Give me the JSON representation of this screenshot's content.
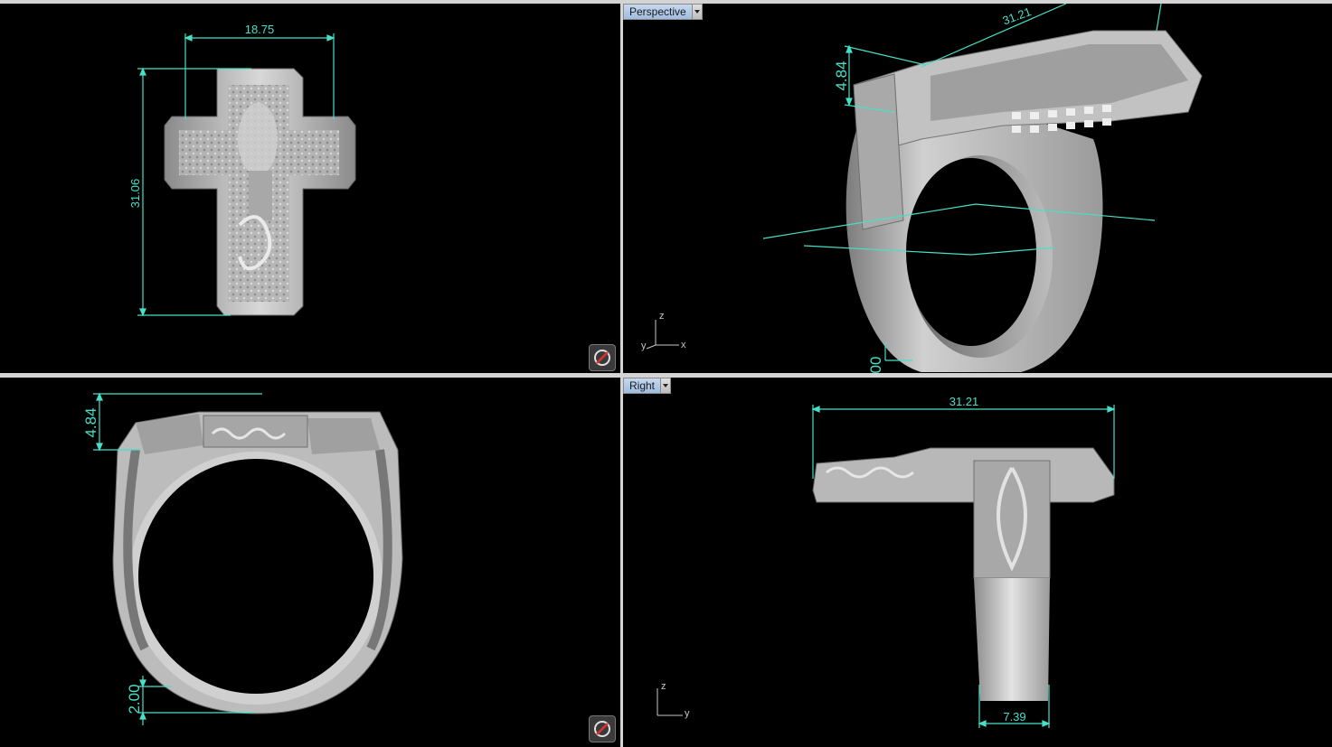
{
  "viewports": {
    "top": {
      "label": "",
      "dimensions": {
        "width": "18.75",
        "height": "31.06"
      }
    },
    "perspective": {
      "label": "Perspective",
      "dimensions": {
        "length": "31.21",
        "height": "4.84",
        "partial": "00"
      },
      "axes": {
        "z": "z",
        "y": "y",
        "x": "x"
      }
    },
    "front": {
      "label": "",
      "dimensions": {
        "height": "4.84",
        "thickness": "2.00"
      }
    },
    "right": {
      "label": "Right",
      "dimensions": {
        "length": "31.21",
        "width": "7.39"
      },
      "axes": {
        "z": "z",
        "y": "y"
      }
    }
  },
  "colors": {
    "viewport_bg": "#000000",
    "dimension": "#46e0c8",
    "metal": "#bdbdbd",
    "active_tab": "#a9c4e6"
  },
  "icons": {
    "navigation": "rotate-lock-icon"
  }
}
